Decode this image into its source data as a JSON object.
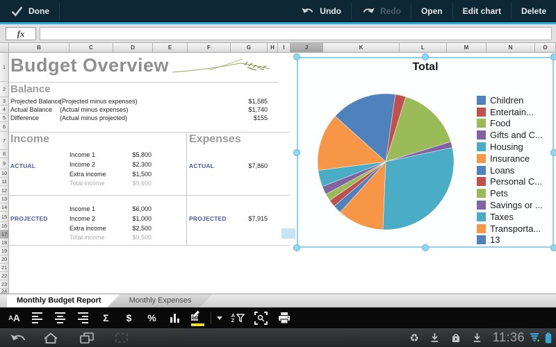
{
  "app": {
    "appbar": {
      "done_label": "Done",
      "undo_label": "Undo",
      "redo_label": "Redo",
      "open_label": "Open",
      "edit_chart_label": "Edit chart",
      "delete_label": "Delete"
    },
    "formula_bar": {
      "fx_label": "fx",
      "value": ""
    },
    "grid": {
      "columns": [
        "B",
        "C",
        "D",
        "E",
        "F",
        "G",
        "H",
        "I",
        "J",
        "K",
        "L",
        "M",
        "N",
        "O"
      ],
      "selected_column": "J",
      "visible_rows": 24,
      "selected_row": 17
    },
    "sheet_tabs": [
      {
        "label": "Monthly Budget Report",
        "active": true
      },
      {
        "label": "Monthly Expenses",
        "active": false
      }
    ],
    "toolbar": {
      "icons": [
        "font-size",
        "align-left",
        "align-center",
        "align-right",
        "sum",
        "currency",
        "percent",
        "insert-chart",
        "highlight-color",
        "dropdown",
        "sort-filter",
        "zoom-select",
        "print"
      ],
      "sum_glyph": "Σ",
      "currency_glyph": "$",
      "percent_glyph": "%",
      "ab_glyph": "ab",
      "sort_a": "A",
      "sort_z": "Z",
      "font_small": "A",
      "font_big": "A"
    },
    "navbar": {
      "icons": [
        "back",
        "home",
        "recent-apps",
        "screenshot",
        "recycle",
        "download",
        "play-store",
        "download",
        "wifi",
        "battery"
      ],
      "time": "11:36"
    }
  },
  "sheet": {
    "title": "Budget Overview",
    "balance": {
      "heading": "Balance",
      "rows": [
        {
          "label": "Projected Balance",
          "desc": "(Projected  minus expenses)",
          "value": "$1,585"
        },
        {
          "label": "Actual Balance",
          "desc": "(Actual  minus expenses)",
          "value": "$1,740"
        },
        {
          "label": "Difference",
          "desc": "(Actual minus projected)",
          "value": "$155"
        }
      ]
    },
    "income": {
      "heading": "Income",
      "actual": {
        "label": "ACTUAL",
        "items": [
          {
            "name": "Income 1",
            "value": "$5,800"
          },
          {
            "name": "Income 2",
            "value": "$2,300"
          },
          {
            "name": "Extra income",
            "value": "$1,500"
          }
        ],
        "total": {
          "name": "Total income",
          "value": "$9,600"
        }
      },
      "projected": {
        "label": "PROJECTED",
        "items": [
          {
            "name": "Income 1",
            "value": "$6,000"
          },
          {
            "name": "Income 2",
            "value": "$1,000"
          },
          {
            "name": "Extra income",
            "value": "$2,500"
          }
        ],
        "total": {
          "name": "Total income",
          "value": "$9,500"
        }
      }
    },
    "expenses": {
      "heading": "Expenses",
      "actual": {
        "label": "ACTUAL",
        "value": "$7,860"
      },
      "projected": {
        "label": "PROJECTED",
        "value": "$7,915"
      }
    }
  },
  "chart_data": {
    "type": "pie",
    "title": "Total",
    "legend_position": "right",
    "start_angle_deg": 312,
    "values_are": "percent, estimated from slice angles",
    "series": [
      {
        "name": "Children",
        "value": 15.6
      },
      {
        "name": "Entertain...",
        "value": 2.5
      },
      {
        "name": "Food",
        "value": 15.5
      },
      {
        "name": "Gifts and C...",
        "value": 1.4
      },
      {
        "name": "Housing",
        "value": 29.0
      },
      {
        "name": "Insurance",
        "value": 11.0
      },
      {
        "name": "Loans",
        "value": 2.0
      },
      {
        "name": "Personal C...",
        "value": 1.7
      },
      {
        "name": "Pets",
        "value": 1.7
      },
      {
        "name": "Savings or ...",
        "value": 2.0
      },
      {
        "name": "Taxes",
        "value": 3.9
      },
      {
        "name": "Transporta...",
        "value": 13.7
      },
      {
        "name": "13",
        "value": 0
      }
    ],
    "colors": [
      "#4F81BD",
      "#C0504D",
      "#9BBB59",
      "#8064A2",
      "#4BACC6",
      "#F79646"
    ]
  }
}
